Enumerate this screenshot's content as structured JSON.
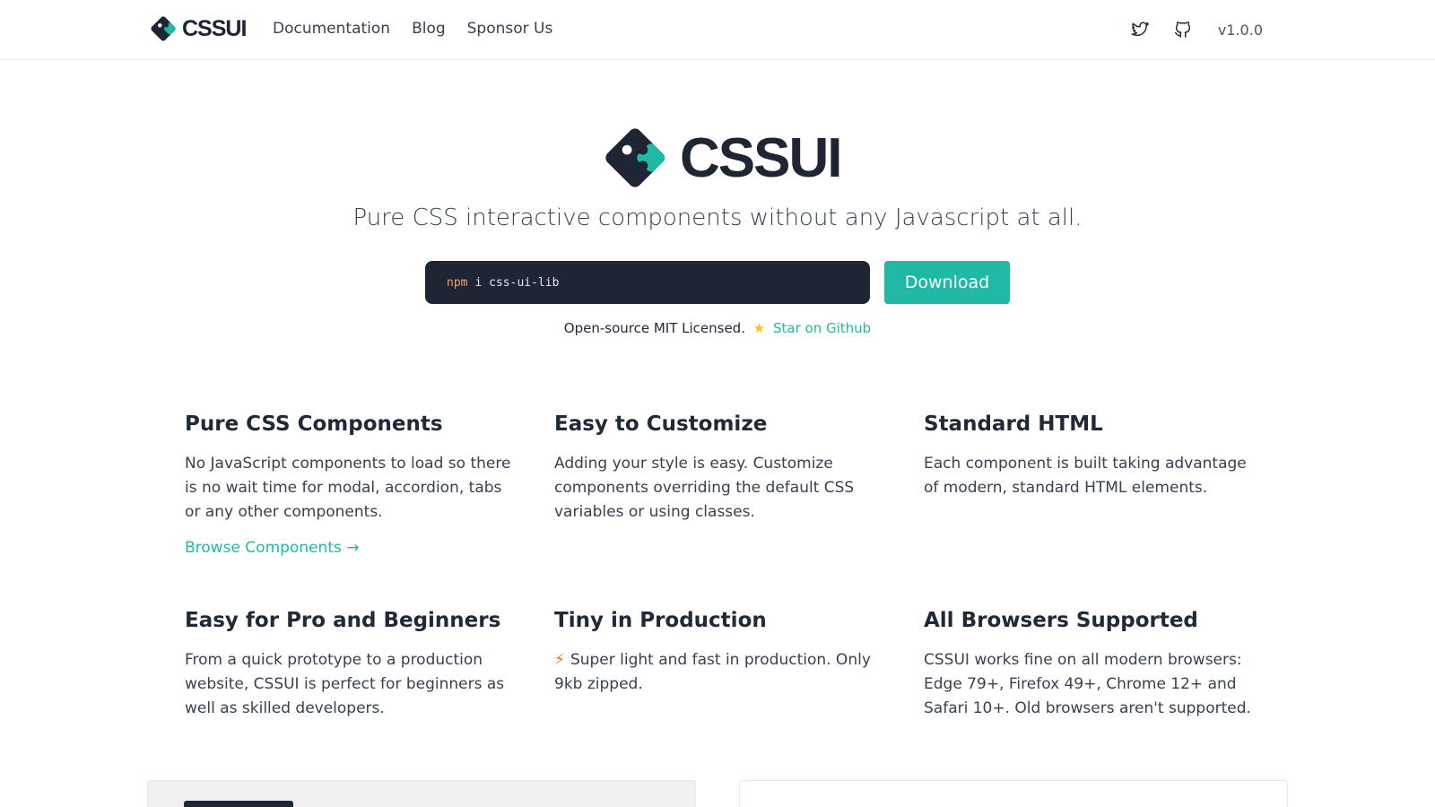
{
  "header": {
    "brand": "CSSUI",
    "nav": [
      "Documentation",
      "Blog",
      "Sponsor Us"
    ],
    "icons": [
      "twitter-icon",
      "github-icon"
    ],
    "version": "v1.0.0"
  },
  "hero": {
    "title": "CSSUI",
    "tagline": "Pure CSS interactive components without any Javascript at all.",
    "install_keyword": "npm",
    "install_rest": "i css-ui-lib",
    "download_label": "Download",
    "license_text": "Open-source MIT Licensed.",
    "star_link": "Star on Github"
  },
  "features": [
    {
      "title": "Pure CSS Components",
      "text": "No JavaScript components to load so there is no wait time for modal, accordion, tabs or any other components.",
      "link": "Browse Components →"
    },
    {
      "title": "Easy to Customize",
      "text": "Adding your style is easy. Customize components overriding the default CSS variables or using classes."
    },
    {
      "title": "Standard HTML",
      "text": "Each component is built taking advantage of modern, standard HTML elements."
    },
    {
      "title": "Easy for Pro and Beginners",
      "text": "From a quick prototype to a production website, CSSUI is perfect for beginners as well as skilled developers."
    },
    {
      "title": "Tiny in Production",
      "text": "Super light and fast in production. Only 9kb zipped."
    },
    {
      "title": "All Browsers Supported",
      "text": "CSSUI works fine on all modern browsers: Edge 79+, Firefox 49+, Chrome 12+ and Safari 10+. Old browsers aren't supported."
    }
  ],
  "colors": {
    "accent": "#1fb9a6",
    "dark": "#1e2533",
    "npm": "#f59e6b",
    "star": "#f5c518",
    "bolt": "#f97316"
  }
}
